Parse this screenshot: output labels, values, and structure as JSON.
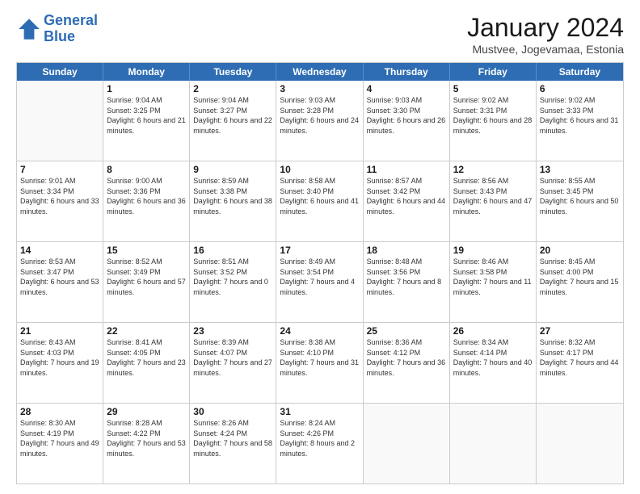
{
  "logo": {
    "line1": "General",
    "line2": "Blue"
  },
  "title": "January 2024",
  "location": "Mustvee, Jogevamaa, Estonia",
  "weekdays": [
    "Sunday",
    "Monday",
    "Tuesday",
    "Wednesday",
    "Thursday",
    "Friday",
    "Saturday"
  ],
  "weeks": [
    [
      {
        "day": "",
        "sunrise": "",
        "sunset": "",
        "daylight": ""
      },
      {
        "day": "1",
        "sunrise": "Sunrise: 9:04 AM",
        "sunset": "Sunset: 3:25 PM",
        "daylight": "Daylight: 6 hours and 21 minutes."
      },
      {
        "day": "2",
        "sunrise": "Sunrise: 9:04 AM",
        "sunset": "Sunset: 3:27 PM",
        "daylight": "Daylight: 6 hours and 22 minutes."
      },
      {
        "day": "3",
        "sunrise": "Sunrise: 9:03 AM",
        "sunset": "Sunset: 3:28 PM",
        "daylight": "Daylight: 6 hours and 24 minutes."
      },
      {
        "day": "4",
        "sunrise": "Sunrise: 9:03 AM",
        "sunset": "Sunset: 3:30 PM",
        "daylight": "Daylight: 6 hours and 26 minutes."
      },
      {
        "day": "5",
        "sunrise": "Sunrise: 9:02 AM",
        "sunset": "Sunset: 3:31 PM",
        "daylight": "Daylight: 6 hours and 28 minutes."
      },
      {
        "day": "6",
        "sunrise": "Sunrise: 9:02 AM",
        "sunset": "Sunset: 3:33 PM",
        "daylight": "Daylight: 6 hours and 31 minutes."
      }
    ],
    [
      {
        "day": "7",
        "sunrise": "Sunrise: 9:01 AM",
        "sunset": "Sunset: 3:34 PM",
        "daylight": "Daylight: 6 hours and 33 minutes."
      },
      {
        "day": "8",
        "sunrise": "Sunrise: 9:00 AM",
        "sunset": "Sunset: 3:36 PM",
        "daylight": "Daylight: 6 hours and 36 minutes."
      },
      {
        "day": "9",
        "sunrise": "Sunrise: 8:59 AM",
        "sunset": "Sunset: 3:38 PM",
        "daylight": "Daylight: 6 hours and 38 minutes."
      },
      {
        "day": "10",
        "sunrise": "Sunrise: 8:58 AM",
        "sunset": "Sunset: 3:40 PM",
        "daylight": "Daylight: 6 hours and 41 minutes."
      },
      {
        "day": "11",
        "sunrise": "Sunrise: 8:57 AM",
        "sunset": "Sunset: 3:42 PM",
        "daylight": "Daylight: 6 hours and 44 minutes."
      },
      {
        "day": "12",
        "sunrise": "Sunrise: 8:56 AM",
        "sunset": "Sunset: 3:43 PM",
        "daylight": "Daylight: 6 hours and 47 minutes."
      },
      {
        "day": "13",
        "sunrise": "Sunrise: 8:55 AM",
        "sunset": "Sunset: 3:45 PM",
        "daylight": "Daylight: 6 hours and 50 minutes."
      }
    ],
    [
      {
        "day": "14",
        "sunrise": "Sunrise: 8:53 AM",
        "sunset": "Sunset: 3:47 PM",
        "daylight": "Daylight: 6 hours and 53 minutes."
      },
      {
        "day": "15",
        "sunrise": "Sunrise: 8:52 AM",
        "sunset": "Sunset: 3:49 PM",
        "daylight": "Daylight: 6 hours and 57 minutes."
      },
      {
        "day": "16",
        "sunrise": "Sunrise: 8:51 AM",
        "sunset": "Sunset: 3:52 PM",
        "daylight": "Daylight: 7 hours and 0 minutes."
      },
      {
        "day": "17",
        "sunrise": "Sunrise: 8:49 AM",
        "sunset": "Sunset: 3:54 PM",
        "daylight": "Daylight: 7 hours and 4 minutes."
      },
      {
        "day": "18",
        "sunrise": "Sunrise: 8:48 AM",
        "sunset": "Sunset: 3:56 PM",
        "daylight": "Daylight: 7 hours and 8 minutes."
      },
      {
        "day": "19",
        "sunrise": "Sunrise: 8:46 AM",
        "sunset": "Sunset: 3:58 PM",
        "daylight": "Daylight: 7 hours and 11 minutes."
      },
      {
        "day": "20",
        "sunrise": "Sunrise: 8:45 AM",
        "sunset": "Sunset: 4:00 PM",
        "daylight": "Daylight: 7 hours and 15 minutes."
      }
    ],
    [
      {
        "day": "21",
        "sunrise": "Sunrise: 8:43 AM",
        "sunset": "Sunset: 4:03 PM",
        "daylight": "Daylight: 7 hours and 19 minutes."
      },
      {
        "day": "22",
        "sunrise": "Sunrise: 8:41 AM",
        "sunset": "Sunset: 4:05 PM",
        "daylight": "Daylight: 7 hours and 23 minutes."
      },
      {
        "day": "23",
        "sunrise": "Sunrise: 8:39 AM",
        "sunset": "Sunset: 4:07 PM",
        "daylight": "Daylight: 7 hours and 27 minutes."
      },
      {
        "day": "24",
        "sunrise": "Sunrise: 8:38 AM",
        "sunset": "Sunset: 4:10 PM",
        "daylight": "Daylight: 7 hours and 31 minutes."
      },
      {
        "day": "25",
        "sunrise": "Sunrise: 8:36 AM",
        "sunset": "Sunset: 4:12 PM",
        "daylight": "Daylight: 7 hours and 36 minutes."
      },
      {
        "day": "26",
        "sunrise": "Sunrise: 8:34 AM",
        "sunset": "Sunset: 4:14 PM",
        "daylight": "Daylight: 7 hours and 40 minutes."
      },
      {
        "day": "27",
        "sunrise": "Sunrise: 8:32 AM",
        "sunset": "Sunset: 4:17 PM",
        "daylight": "Daylight: 7 hours and 44 minutes."
      }
    ],
    [
      {
        "day": "28",
        "sunrise": "Sunrise: 8:30 AM",
        "sunset": "Sunset: 4:19 PM",
        "daylight": "Daylight: 7 hours and 49 minutes."
      },
      {
        "day": "29",
        "sunrise": "Sunrise: 8:28 AM",
        "sunset": "Sunset: 4:22 PM",
        "daylight": "Daylight: 7 hours and 53 minutes."
      },
      {
        "day": "30",
        "sunrise": "Sunrise: 8:26 AM",
        "sunset": "Sunset: 4:24 PM",
        "daylight": "Daylight: 7 hours and 58 minutes."
      },
      {
        "day": "31",
        "sunrise": "Sunrise: 8:24 AM",
        "sunset": "Sunset: 4:26 PM",
        "daylight": "Daylight: 8 hours and 2 minutes."
      },
      {
        "day": "",
        "sunrise": "",
        "sunset": "",
        "daylight": ""
      },
      {
        "day": "",
        "sunrise": "",
        "sunset": "",
        "daylight": ""
      },
      {
        "day": "",
        "sunrise": "",
        "sunset": "",
        "daylight": ""
      }
    ]
  ]
}
